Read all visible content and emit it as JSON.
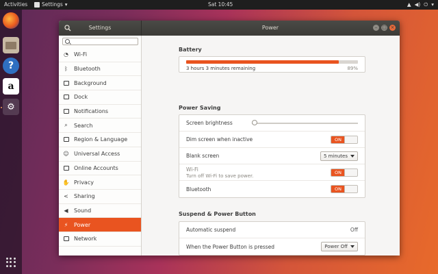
{
  "topbar": {
    "activities": "Activities",
    "app_name": "Settings",
    "app_caret": "▾",
    "clock": "Sat 10:45",
    "tray": {
      "network": "▲",
      "volume": "◀)",
      "power": "⏻",
      "caret": "▾"
    }
  },
  "dock": {
    "items": [
      {
        "name": "Firefox",
        "icon": "firefox-icon"
      },
      {
        "name": "Files",
        "icon": "files-icon"
      },
      {
        "name": "Help",
        "icon": "help-icon",
        "glyph": "?"
      },
      {
        "name": "Amazon",
        "icon": "amazon-icon",
        "glyph": "a"
      },
      {
        "name": "Settings",
        "icon": "settings-icon",
        "glyph": "⚙"
      }
    ]
  },
  "window": {
    "sidebar_title": "Settings",
    "page_title": "Power",
    "controls": {
      "minimize": "–",
      "maximize": "□",
      "close": "×"
    }
  },
  "sidebar": {
    "search_value": "",
    "items": [
      {
        "label": "Wi-Fi",
        "glyph": "◔"
      },
      {
        "label": "Bluetooth",
        "glyph": "ᛒ"
      },
      {
        "label": "Background",
        "glyph": ""
      },
      {
        "label": "Dock",
        "glyph": ""
      },
      {
        "label": "Notifications",
        "glyph": ""
      },
      {
        "label": "Search",
        "glyph": "⌕"
      },
      {
        "label": "Region & Language",
        "glyph": ""
      },
      {
        "label": "Universal Access",
        "glyph": "☺"
      },
      {
        "label": "Online Accounts",
        "glyph": ""
      },
      {
        "label": "Privacy",
        "glyph": "✋"
      },
      {
        "label": "Sharing",
        "glyph": "<"
      },
      {
        "label": "Sound",
        "glyph": "◀"
      },
      {
        "label": "Power",
        "glyph": "⚡"
      },
      {
        "label": "Network",
        "glyph": ""
      }
    ],
    "selected_index": 12
  },
  "battery": {
    "heading": "Battery",
    "remaining": "3 hours 3 minutes remaining",
    "percent_label": "89%",
    "percent": 89
  },
  "power_saving": {
    "heading": "Power Saving",
    "screen_brightness": {
      "label": "Screen brightness",
      "level": 0
    },
    "dim_screen": {
      "label": "Dim screen when inactive",
      "state": "ON"
    },
    "blank_screen": {
      "label": "Blank screen",
      "value": "5 minutes"
    },
    "wifi": {
      "label": "Wi-Fi",
      "sublabel": "Turn off Wi-Fi to save power.",
      "state": "ON"
    },
    "bluetooth": {
      "label": "Bluetooth",
      "state": "ON"
    }
  },
  "suspend": {
    "heading": "Suspend & Power Button",
    "automatic_suspend": {
      "label": "Automatic suspend",
      "value": "Off"
    },
    "power_button": {
      "label": "When the Power Button is pressed",
      "value": "Power Off"
    }
  },
  "colors": {
    "accent": "#e95420",
    "titlebar": "#3c3b37",
    "topbar": "#1e1e1e"
  }
}
